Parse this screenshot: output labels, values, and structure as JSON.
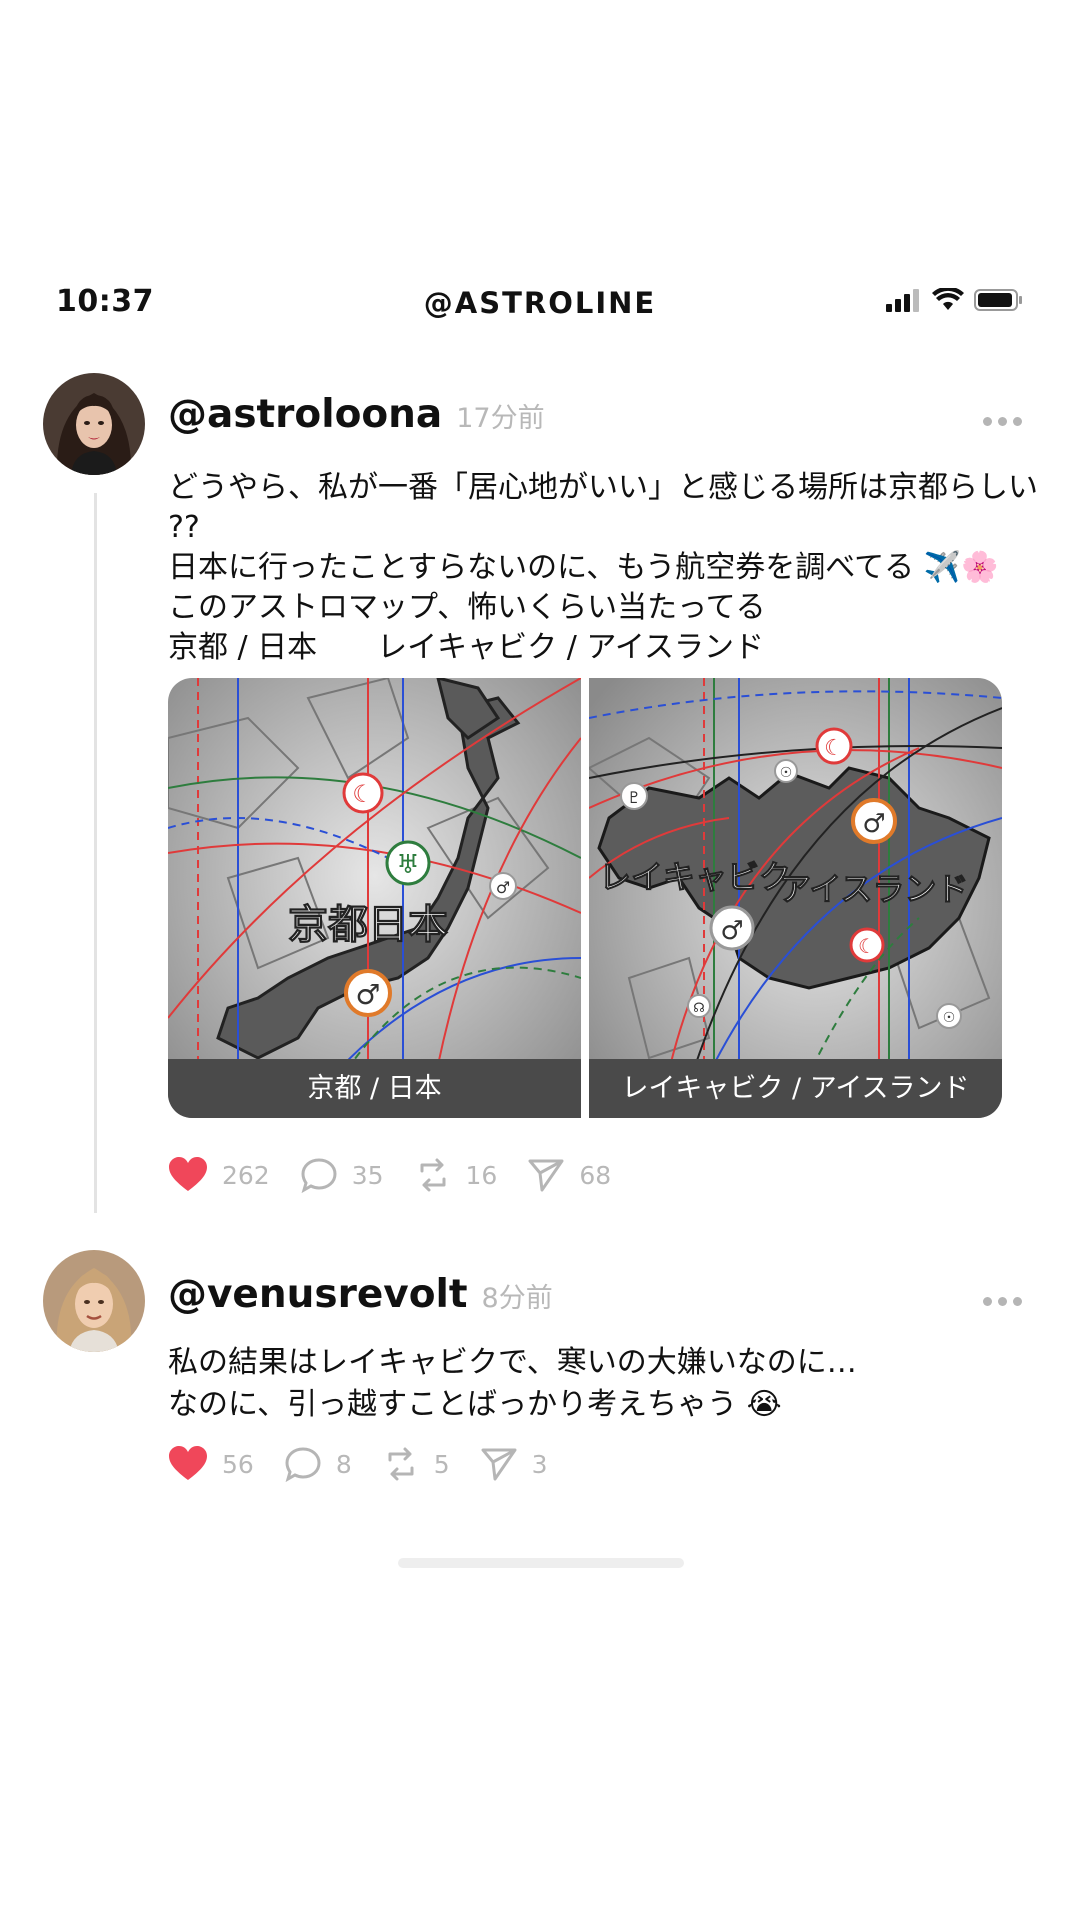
{
  "status_bar": {
    "time": "10:37",
    "title": "@ASTROLINE"
  },
  "posts": [
    {
      "username": "@astroloona",
      "time": "17分前",
      "text": "どうやら、私が一番「居心地がいい」と感じる場所は京都らしい\n??\n日本に行ったことすらないのに、もう航空券を調べてる ✈️🌸\nこのアストロマップ、怖いくらい当たってる\n京都 / 日本　　レイキャビク / アイスランド",
      "media": [
        {
          "caption": "京都 / 日本",
          "overlay": "京都日本"
        },
        {
          "caption": "レイキャビク / アイスランド",
          "overlay_left": "レイキャビク",
          "overlay_right": "アイスランド"
        }
      ],
      "likes": "262",
      "replies": "35",
      "reposts": "16",
      "shares": "68"
    },
    {
      "username": "@venusrevolt",
      "time": "8分前",
      "text": "私の結果はレイキャビクで、寒いの大嫌いなのに…\nなのに、引っ越すことばっかり考えちゃう 😭",
      "likes": "56",
      "replies": "8",
      "reposts": "5",
      "shares": "3"
    }
  ],
  "colors": {
    "like": "#f0475a",
    "muted": "#b8b8b8",
    "line_red": "#e03a3a",
    "line_blue": "#2a4fd6",
    "line_green": "#2e7d3e"
  }
}
